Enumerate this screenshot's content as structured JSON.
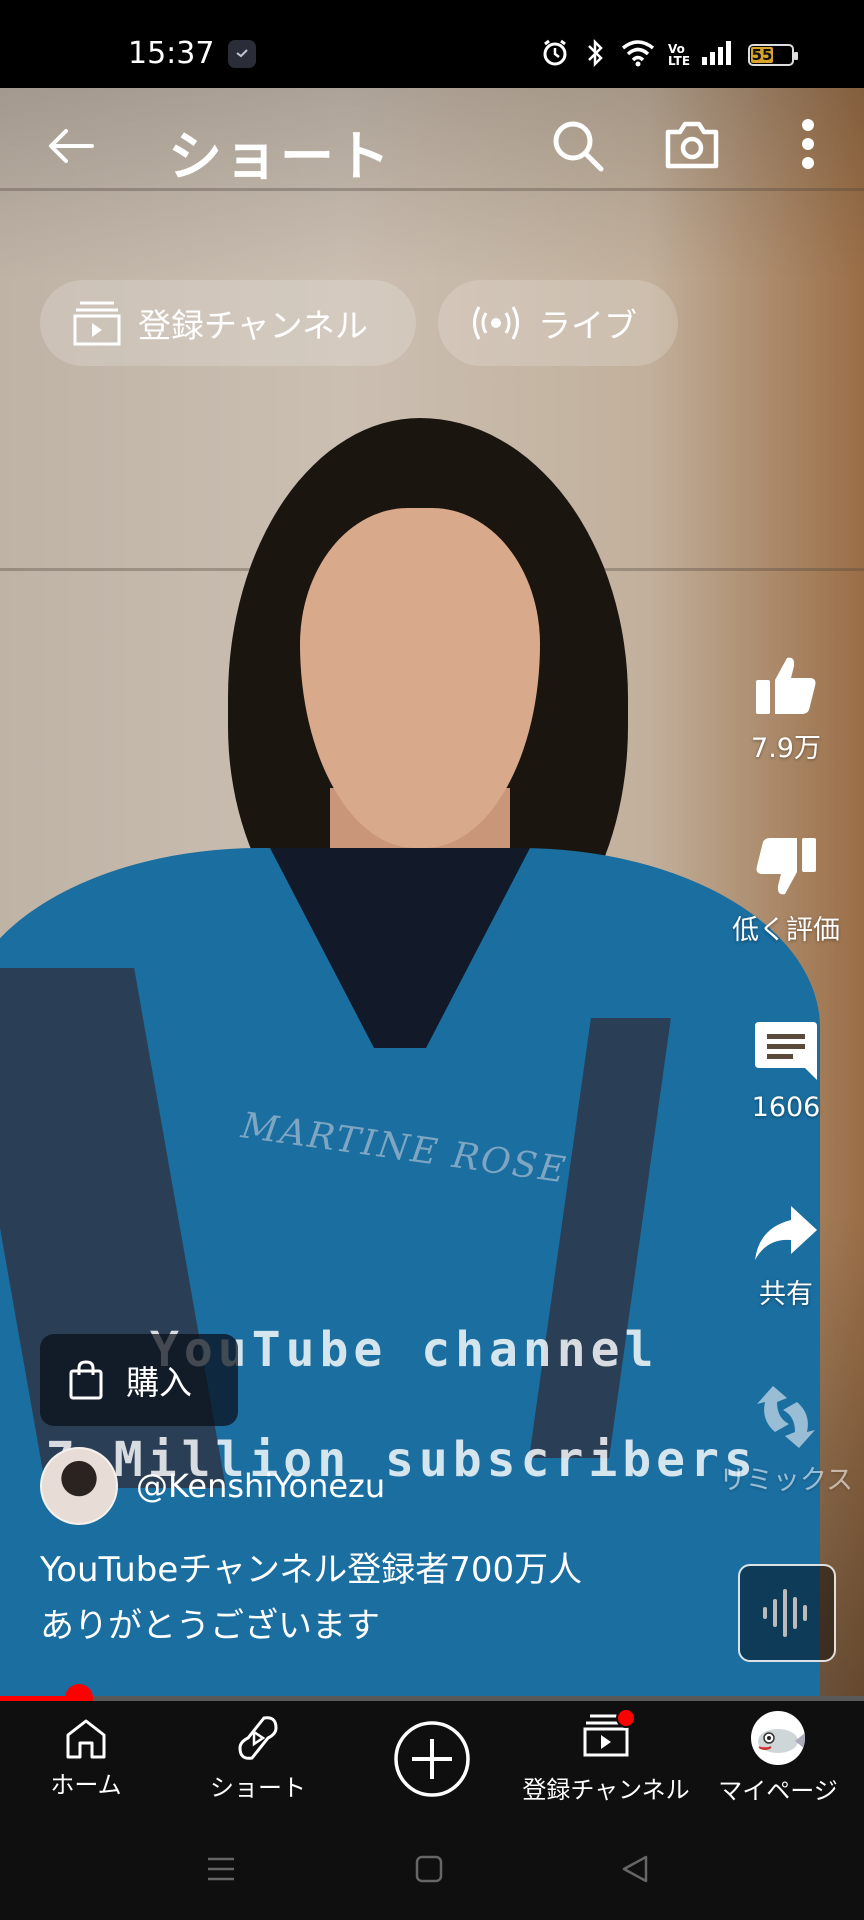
{
  "status_bar": {
    "time": "15:37",
    "network": "Vo LTE",
    "battery": "55",
    "battery_level": 0.55
  },
  "top_bar": {
    "title": "ショート"
  },
  "chips": [
    {
      "label": "登録チャンネル",
      "icon": "subscriptions-icon"
    },
    {
      "label": "ライブ",
      "icon": "live-icon"
    }
  ],
  "video_overlay": {
    "line1": "YouTube channel",
    "line2": "7 Million subscribers"
  },
  "actions": {
    "like": "7.9万",
    "dislike": "低く評価",
    "comments": "1606",
    "share": "共有",
    "remix": "リミックス"
  },
  "buy": {
    "label": "購入"
  },
  "channel": {
    "handle": "@KenshiYonezu"
  },
  "caption": {
    "line1": "YouTubeチャンネル登録者700万人",
    "line2": "ありがとうございます"
  },
  "progress": {
    "fraction": 0.092
  },
  "bottom_nav": {
    "home": "ホーム",
    "shorts": "ショート",
    "subscriptions": "登録チャンネル",
    "mypage": "マイページ"
  },
  "colors": {
    "accent": "#ff0000",
    "nav_bg": "#0f0f0f",
    "battery": "#d7a32b"
  }
}
